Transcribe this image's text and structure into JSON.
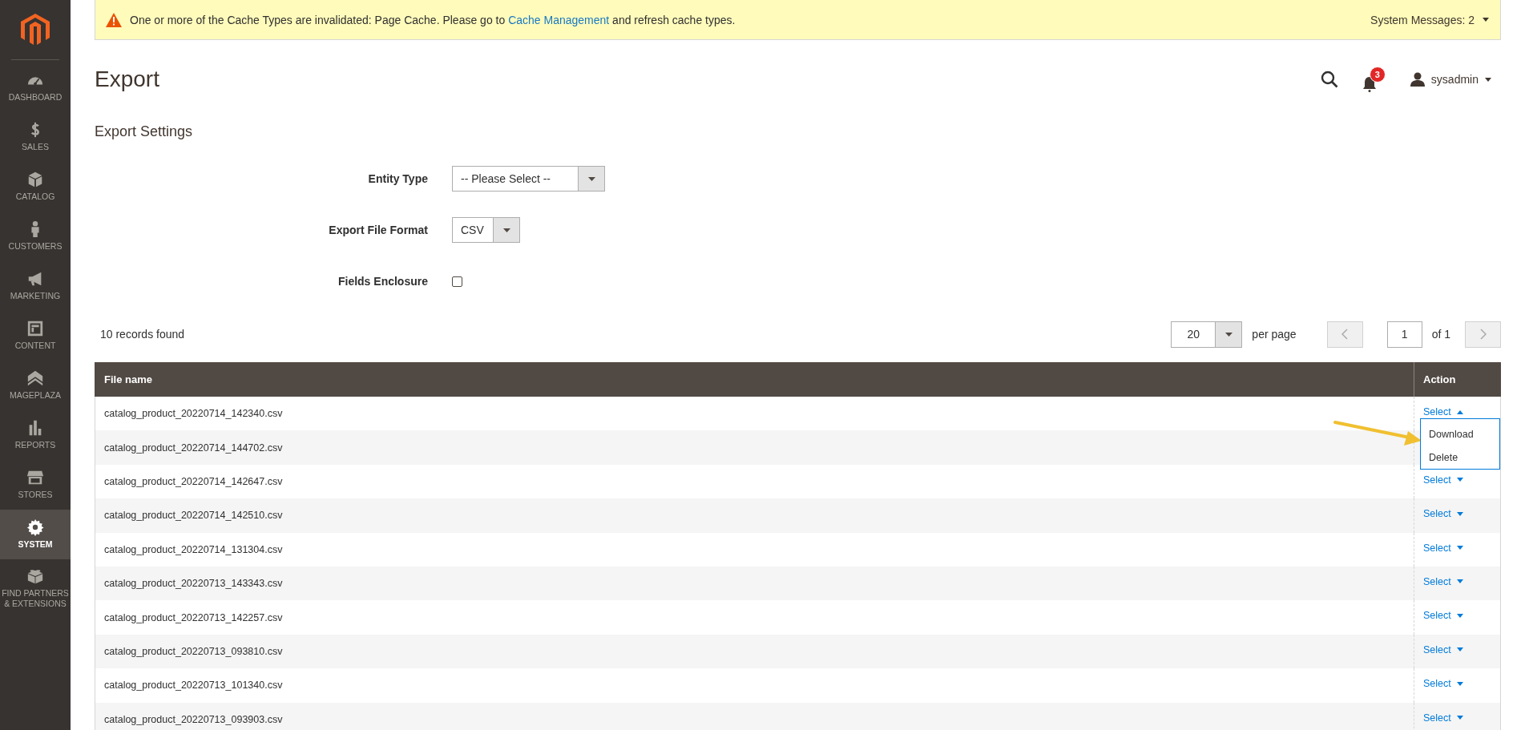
{
  "sidebar": {
    "items": [
      {
        "label": "DASHBOARD",
        "selected": false
      },
      {
        "label": "SALES",
        "selected": false
      },
      {
        "label": "CATALOG",
        "selected": false
      },
      {
        "label": "CUSTOMERS",
        "selected": false
      },
      {
        "label": "MARKETING",
        "selected": false
      },
      {
        "label": "CONTENT",
        "selected": false
      },
      {
        "label": "MAGEPLAZA",
        "selected": false
      },
      {
        "label": "REPORTS",
        "selected": false
      },
      {
        "label": "STORES",
        "selected": false
      },
      {
        "label": "SYSTEM",
        "selected": true
      },
      {
        "label": "FIND PARTNERS & EXTENSIONS",
        "selected": false
      }
    ]
  },
  "message": {
    "text_before": "One or more of the Cache Types are invalidated: Page Cache. Please go to",
    "link": "Cache Management",
    "text_after": "and refresh cache types.",
    "summary": "System Messages: 2"
  },
  "header": {
    "title": "Export",
    "notifications": "3",
    "user": "sysadmin"
  },
  "section_title": "Export Settings",
  "form": {
    "fields": [
      {
        "kind": "select",
        "label": "Entity Type",
        "value": "-- Please Select --"
      },
      {
        "kind": "select",
        "label": "Export File Format",
        "value": "CSV"
      },
      {
        "kind": "checkbox",
        "label": "Fields Enclosure",
        "checked": false
      }
    ]
  },
  "grid": {
    "records": "10 records found",
    "page_size": "20",
    "per_page_label": "per page",
    "page": "1",
    "of_pages": "of 1",
    "columns": [
      "File name",
      "Action"
    ],
    "rows": [
      {
        "file": "catalog_product_20220714_142340.csv",
        "action": "Select",
        "expanded": true
      },
      {
        "file": "catalog_product_20220714_144702.csv"
      },
      {
        "file": "catalog_product_20220714_142647.csv",
        "action": "Select",
        "expanded": false
      },
      {
        "file": "catalog_product_20220714_142510.csv",
        "action": "Select",
        "expanded": false
      },
      {
        "file": "catalog_product_20220714_131304.csv",
        "action": "Select",
        "expanded": false
      },
      {
        "file": "catalog_product_20220713_143343.csv",
        "action": "Select",
        "expanded": false
      },
      {
        "file": "catalog_product_20220713_142257.csv",
        "action": "Select",
        "expanded": false
      },
      {
        "file": "catalog_product_20220713_093810.csv",
        "action": "Select",
        "expanded": false
      },
      {
        "file": "catalog_product_20220713_101340.csv",
        "action": "Select",
        "expanded": false
      },
      {
        "file": "catalog_product_20220713_093903.csv",
        "action": "Select",
        "expanded": false
      }
    ],
    "menu": [
      "Download",
      "Delete"
    ]
  }
}
